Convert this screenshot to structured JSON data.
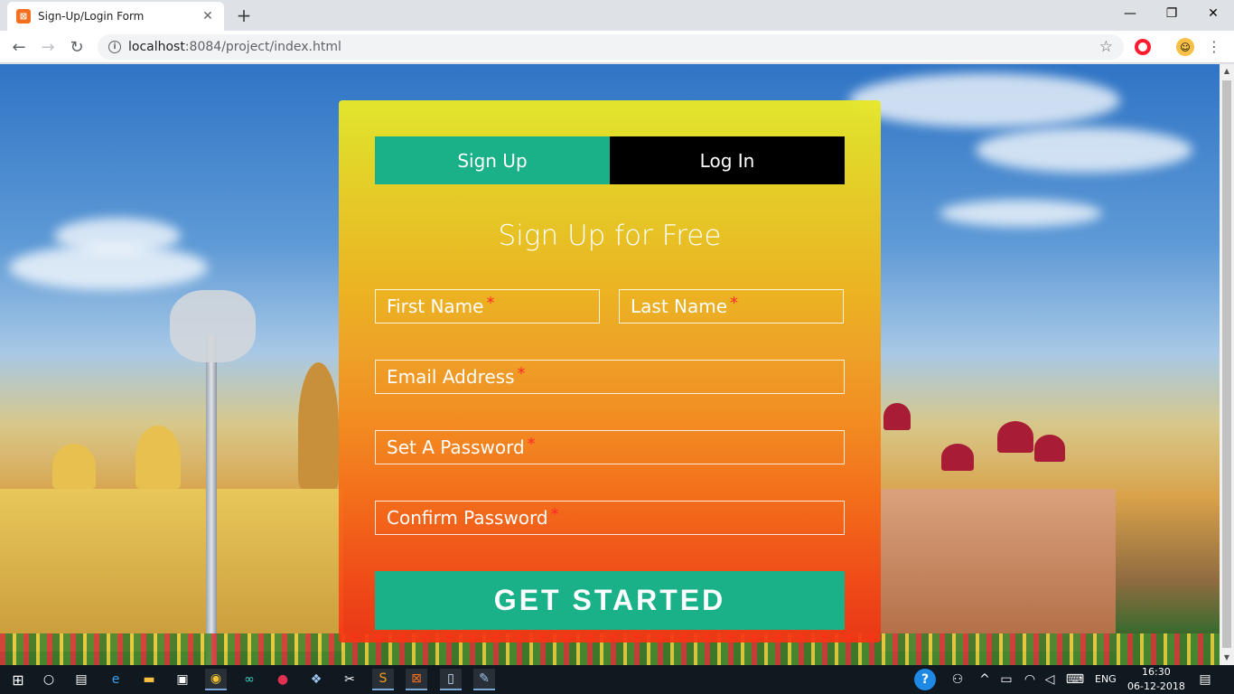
{
  "browser": {
    "tab_title": "Sign-Up/Login Form",
    "url_host": "localhost",
    "url_rest": ":8084/project/index.html"
  },
  "form": {
    "tabs": {
      "signup": "Sign Up",
      "login": "Log In"
    },
    "title": "Sign Up for Free",
    "fields": {
      "first_name": "First Name",
      "last_name": "Last Name",
      "email": "Email Address",
      "password": "Set A Password",
      "confirm": "Confirm Password",
      "required_mark": "*"
    },
    "submit": "GET STARTED",
    "colors": {
      "accent": "#1ab188",
      "login_tab": "#000000"
    }
  },
  "taskbar": {
    "language": "ENG",
    "time": "16:30",
    "date": "06-12-2018"
  }
}
